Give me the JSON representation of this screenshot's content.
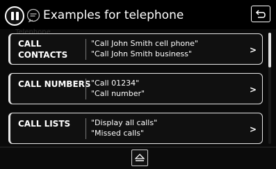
{
  "header": {
    "title": "Examples for telephone",
    "voice_button_icon": "pause-icon",
    "speech_icon": "speech-bubble-icon",
    "back_icon": "return-arrow-icon"
  },
  "ghost_text": "Telephone",
  "items": [
    {
      "label": "CALL\nCONTACTS",
      "examples": "\"Call John Smith cell phone\"\n\"Call John Smith business\"",
      "chevron": ">"
    },
    {
      "label": "CALL NUMBERS",
      "examples": "\"Call 01234\"\n\"Call number\"",
      "chevron": ">"
    },
    {
      "label": "CALL LISTS",
      "examples": "\"Display all calls\"\n\"Missed calls\"",
      "chevron": ">"
    }
  ],
  "footer": {
    "eject_icon": "eject-icon"
  },
  "colors": {
    "background": "#0a0a0a",
    "text": "#ffffff",
    "border": "#e8e8e8"
  }
}
